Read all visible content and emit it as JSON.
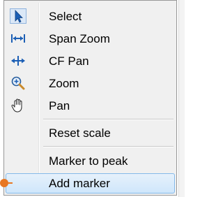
{
  "menu": {
    "items": [
      {
        "label": "Select",
        "icon": "cursor-arrow-icon",
        "highlighted": false
      },
      {
        "label": "Span Zoom",
        "icon": "span-zoom-icon",
        "highlighted": false
      },
      {
        "label": "CF Pan",
        "icon": "cf-pan-icon",
        "highlighted": false
      },
      {
        "label": "Zoom",
        "icon": "zoom-magnifier-icon",
        "highlighted": false
      },
      {
        "label": "Pan",
        "icon": "pan-hand-icon",
        "highlighted": false
      },
      {
        "label": "Reset scale",
        "icon": null,
        "highlighted": false
      },
      {
        "label": "Marker to peak",
        "icon": null,
        "highlighted": false
      },
      {
        "label": "Add marker",
        "icon": null,
        "highlighted": true
      }
    ]
  },
  "colors": {
    "menu_background": "#f0f0f0",
    "highlight_border": "#84b9e9",
    "highlight_fill": "#cfe6fb",
    "icon_blue": "#1c5fb5",
    "marker_orange": "#e87722"
  }
}
